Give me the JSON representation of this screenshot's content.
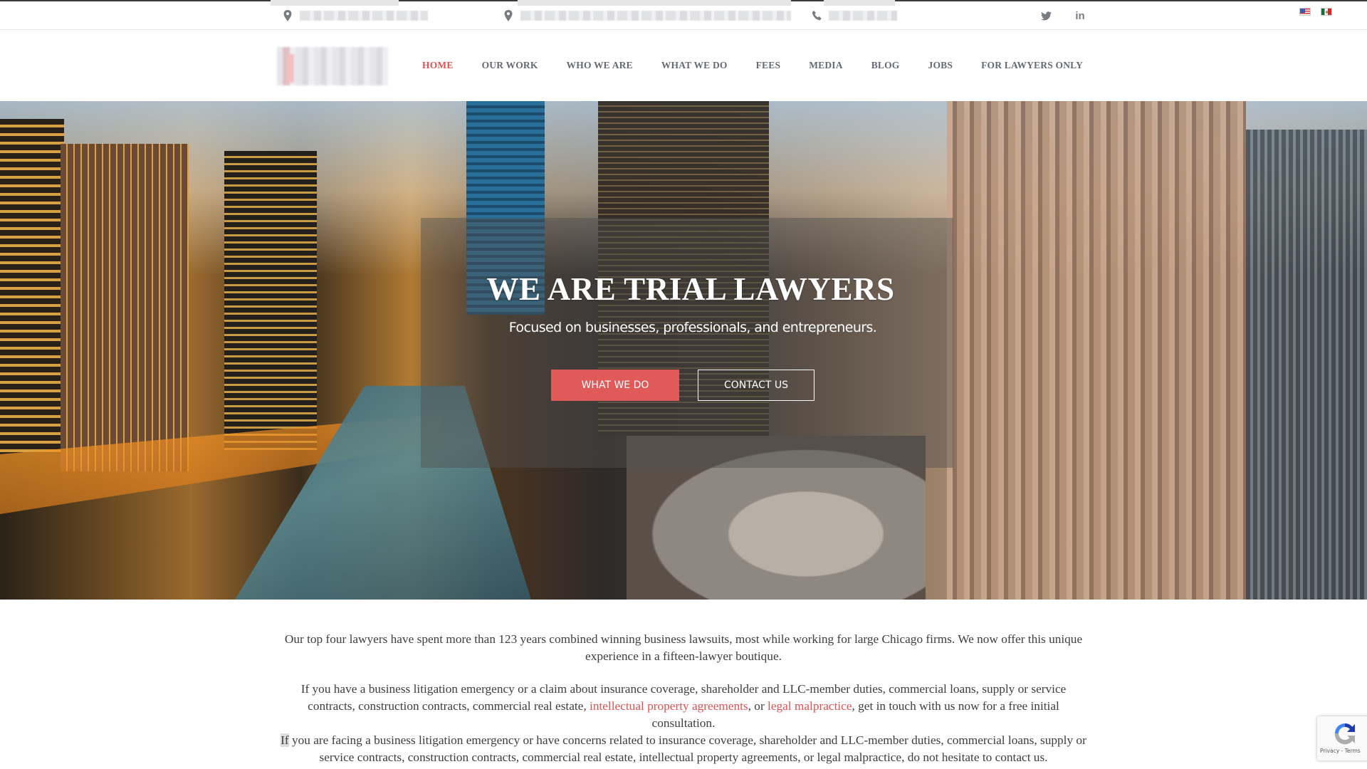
{
  "topbar": {
    "address_1": "[redacted address]",
    "address_2": "[redacted address]",
    "phone": "[redacted phone]",
    "social": [
      {
        "name": "twitter",
        "label": "🐦"
      },
      {
        "name": "linkedin",
        "label": "in"
      }
    ],
    "languages": [
      "English (US)",
      "Español (MX)"
    ]
  },
  "header": {
    "logo_alt": "[redacted logo]",
    "nav": [
      {
        "label": "HOME",
        "active": true
      },
      {
        "label": "OUR WORK"
      },
      {
        "label": "WHO WE ARE"
      },
      {
        "label": "WHAT WE DO"
      },
      {
        "label": "FEES"
      },
      {
        "label": "MEDIA"
      },
      {
        "label": "BLOG"
      },
      {
        "label": "JOBS"
      },
      {
        "label": "FOR LAWYERS ONLY"
      }
    ]
  },
  "hero": {
    "title": "WE ARE TRIAL LAWYERS",
    "subtitle": "Focused on businesses, professionals, and entrepreneurs.",
    "primary_button": "WHAT WE DO",
    "secondary_button": "CONTACT US"
  },
  "content": {
    "p1": "Our top four lawyers have spent more than 123 years combined winning business lawsuits, most while working for large Chicago firms. We now offer this unique experience in a fifteen-lawyer boutique.",
    "p2_before": "If you have a business litigation emergency or a claim about insurance coverage, shareholder and LLC-member duties, commercial loans, supply or service contracts, construction contracts, commercial real estate, ",
    "p2_link1": "intellectual property agreements",
    "p2_mid": ", or ",
    "p2_link2": "legal malpractice",
    "p2_after": ", get in touch with us now for a free initial consultation.",
    "p3_highlight": "If",
    "p3_rest": " you are facing a business litigation emergency or have concerns related to insurance coverage, shareholder and LLC-member duties, commercial loans, supply or service contracts, construction contracts, commercial real estate, intellectual property agreements, or legal malpractice, do not hesitate to contact us."
  },
  "recaptcha": {
    "label": "Privacy - Terms"
  },
  "colors": {
    "accent": "#e05252",
    "button": "#e05a5a",
    "nav_text": "#666a70",
    "body_text": "#3e3e3e"
  }
}
